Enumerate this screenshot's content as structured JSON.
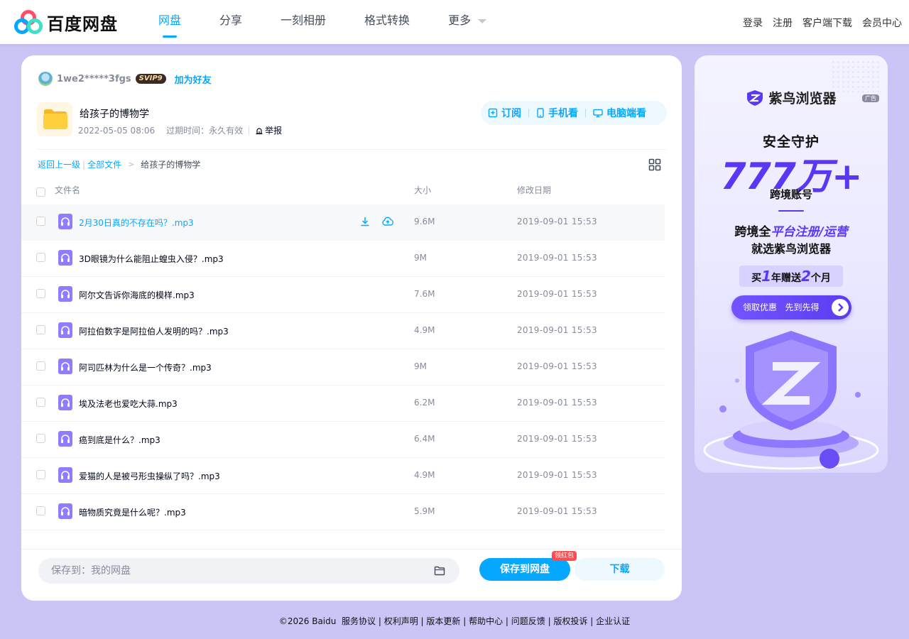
{
  "brand": {
    "name": "百度网盘",
    "colors": {
      "accent": "#06a7ff",
      "page_bg": "#c9c5f6",
      "ad_purple": "#5a38f3"
    }
  },
  "nav": {
    "items": [
      {
        "label": "网盘",
        "active": true
      },
      {
        "label": "分享",
        "active": false
      },
      {
        "label": "一刻相册",
        "active": false
      },
      {
        "label": "格式转换",
        "active": false
      },
      {
        "label": "更多",
        "active": false
      }
    ],
    "more_icon": "chevron-down-icon"
  },
  "top_links": {
    "login": "登录",
    "register": "注册",
    "client_download": "客户端下载",
    "vip_center": "会员中心"
  },
  "share": {
    "owner": {
      "name": "1we2*****3fgs",
      "badge": "SVIP9",
      "add_friend": "加为好友"
    },
    "folder_title": "给孩子的博物学",
    "created": "2022-05-05 08:06",
    "expire": "过期时间：永久有效",
    "report": "举报",
    "view_options": {
      "subscribe": "订阅",
      "phone": "手机看",
      "pc": "电脑端看"
    }
  },
  "breadcrumb": {
    "back": "返回上一级",
    "all_files": "全部文件",
    "current": "给孩子的博物学"
  },
  "table": {
    "headers": {
      "name": "文件名",
      "size": "大小",
      "modified": "修改日期"
    },
    "rows": [
      {
        "name": "2月30日真的不存在吗？.mp3",
        "size": "9.6M",
        "date": "2019-09-01 15:53"
      },
      {
        "name": "3D眼镜为什么能阻止蝗虫入侵？.mp3",
        "size": "9M",
        "date": "2019-09-01 15:53"
      },
      {
        "name": "阿尔文告诉你海底的模样.mp3",
        "size": "7.6M",
        "date": "2019-09-01 15:53"
      },
      {
        "name": "阿拉伯数字是阿拉伯人发明的吗？.mp3",
        "size": "4.9M",
        "date": "2019-09-01 15:53"
      },
      {
        "name": "阿司匹林为什么是一个传奇？.mp3",
        "size": "9M",
        "date": "2019-09-01 15:53"
      },
      {
        "name": "埃及法老也爱吃大蒜.mp3",
        "size": "6.2M",
        "date": "2019-09-01 15:53"
      },
      {
        "name": "癌到底是什么？.mp3",
        "size": "6.4M",
        "date": "2019-09-01 15:53"
      },
      {
        "name": "爱猫的人是被弓形虫操纵了吗？.mp3",
        "size": "4.9M",
        "date": "2019-09-01 15:53"
      },
      {
        "name": "暗物质究竟是什么呢？.mp3",
        "size": "5.9M",
        "date": "2019-09-01 15:53"
      }
    ]
  },
  "bottom": {
    "save_path": "保存到：我的网盘",
    "save_button": "保存到网盘",
    "red_packet": "领红包",
    "download_button": "下载"
  },
  "ad": {
    "tag": "广告",
    "brand": "紫鸟浏览器",
    "line1": "安全守护",
    "big": "777万+",
    "line2": "跨境账号",
    "line3_prefix": "跨境全",
    "line3_highlight": "平台注册/运营",
    "line4": "就选紫鸟浏览器",
    "promo_a": "买",
    "promo_n1": "1",
    "promo_b": "年赠送",
    "promo_n2": "2",
    "promo_c": "个月",
    "cta": "领取优惠   先到先得"
  },
  "footer": {
    "copyright": "©2026 Baidu",
    "links": [
      "服务协议",
      "权利声明",
      "版本更新",
      "帮助中心",
      "问题反馈",
      "版权投诉",
      "企业认证"
    ]
  }
}
